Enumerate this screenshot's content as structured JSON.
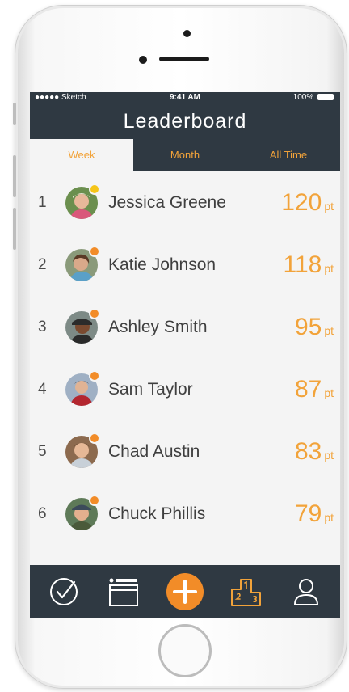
{
  "status_bar": {
    "carrier": "●●●●● Sketch",
    "time": "9:41 AM",
    "battery": "100%"
  },
  "header": {
    "title": "Leaderboard"
  },
  "tabs": [
    {
      "label": "Week",
      "active": true
    },
    {
      "label": "Month",
      "active": false
    },
    {
      "label": "All Time",
      "active": false
    }
  ],
  "leaderboard": [
    {
      "rank": "1",
      "name": "Jessica Greene",
      "points": "120",
      "unit": "pt",
      "status_color": "#f5c518"
    },
    {
      "rank": "2",
      "name": "Katie Johnson",
      "points": "118",
      "unit": "pt",
      "status_color": "#f28c28"
    },
    {
      "rank": "3",
      "name": "Ashley Smith",
      "points": "95",
      "unit": "pt",
      "status_color": "#f28c28"
    },
    {
      "rank": "4",
      "name": "Sam Taylor",
      "points": "87",
      "unit": "pt",
      "status_color": "#f28c28"
    },
    {
      "rank": "5",
      "name": "Chad Austin",
      "points": "83",
      "unit": "pt",
      "status_color": "#f28c28"
    },
    {
      "rank": "6",
      "name": "Chuck Phillis",
      "points": "79",
      "unit": "pt",
      "status_color": "#f28c28"
    }
  ],
  "bottom_nav": [
    {
      "icon": "check-circle-icon"
    },
    {
      "icon": "calendar-icon"
    },
    {
      "icon": "add-icon"
    },
    {
      "icon": "podium-icon"
    },
    {
      "icon": "profile-icon"
    }
  ],
  "colors": {
    "bar": "#2f3942",
    "accent": "#f2a33a",
    "add_button": "#f28c28",
    "background": "#f4f4f4"
  }
}
